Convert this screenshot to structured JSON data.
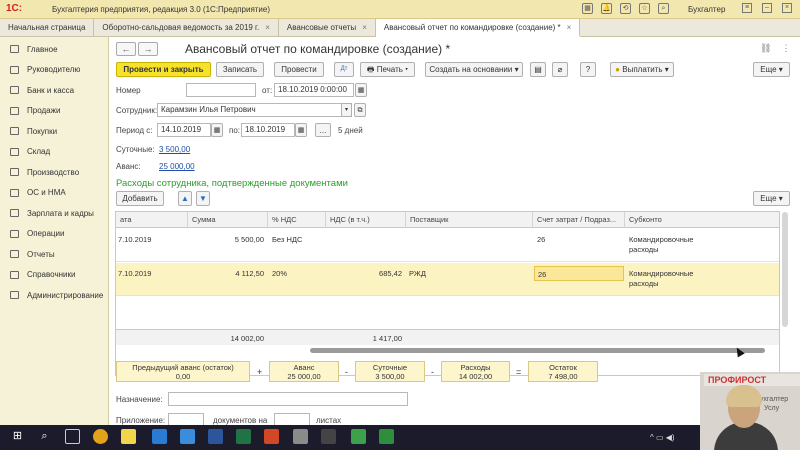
{
  "app": {
    "logo": "1С:",
    "title": "Бухгалтерия предприятия, редакция 3.0  (1С:Предприятие)",
    "user": "Бухгалтер"
  },
  "tabs": [
    {
      "label": "Начальная страница"
    },
    {
      "label": "Оборотно-сальдовая ведомость за 2019 г."
    },
    {
      "label": "Авансовые отчеты"
    },
    {
      "label": "Авансовый отчет по командировке (создание) *"
    }
  ],
  "sidebar": {
    "items": [
      {
        "label": "Главное",
        "icon": "menu-icon"
      },
      {
        "label": "Руководителю",
        "icon": "chart-icon"
      },
      {
        "label": "Банк и касса",
        "icon": "bank-icon"
      },
      {
        "label": "Продажи",
        "icon": "cart-icon"
      },
      {
        "label": "Покупки",
        "icon": "basket-icon"
      },
      {
        "label": "Склад",
        "icon": "warehouse-icon"
      },
      {
        "label": "Производство",
        "icon": "factory-icon"
      },
      {
        "label": "ОС и НМА",
        "icon": "assets-icon"
      },
      {
        "label": "Зарплата и кадры",
        "icon": "people-icon"
      },
      {
        "label": "Операции",
        "icon": "operations-icon"
      },
      {
        "label": "Отчеты",
        "icon": "reports-icon"
      },
      {
        "label": "Справочники",
        "icon": "catalog-icon"
      },
      {
        "label": "Администрирование",
        "icon": "admin-icon"
      }
    ]
  },
  "doc": {
    "title": "Авансовый отчет по командировке (создание) *",
    "toolbar": {
      "post_close": "Провести и закрыть",
      "save": "Записать",
      "post": "Провести",
      "print": "Печать",
      "create_based": "Создать на основании",
      "pay": "Выплатить",
      "more": "Еще",
      "help": "?"
    },
    "fields": {
      "number_label": "Номер",
      "number_value": "",
      "date_from_label": "от:",
      "date_value": "18.10.2019  0:00:00",
      "employee_label": "Сотрудник:",
      "employee_value": "Карамзин Илья Петрович",
      "period_from_label": "Период с:",
      "period_from_value": "14.10.2019",
      "period_to_label": "по:",
      "period_to_value": "18.10.2019",
      "period_days": "5 дней",
      "per_diem_label": "Суточные:",
      "per_diem_value": "3 500,00",
      "advance_label": "Аванс:",
      "advance_value": "25 000,00"
    },
    "section_title": "Расходы сотрудника, подтвержденные документами",
    "add_button": "Добавить",
    "more_button": "Еще",
    "table": {
      "columns": [
        "ата",
        "Сумма",
        "% НДС",
        "НДС (в т.ч.)",
        "Поставщик",
        "Счет затрат / Подраз...",
        "Субконто"
      ],
      "rows": [
        {
          "date": "7.10.2019",
          "sum": "5 500,00",
          "vat_rate": "Без НДС",
          "vat": "",
          "supplier": "",
          "account": "26",
          "subconto_1": "Командировочные",
          "subconto_2": "расходы"
        },
        {
          "date": "7.10.2019",
          "sum": "4 112,50",
          "vat_rate": "20%",
          "vat": "685,42",
          "supplier": "РЖД",
          "account": "26",
          "subconto_1": "Командировочные",
          "subconto_2": "расходы"
        }
      ],
      "footer": {
        "sum": "14 002,00",
        "vat": "1 417,00"
      }
    },
    "summary": [
      {
        "label": "Предыдущий аванс (остаток)",
        "value": "0,00"
      },
      {
        "label": "Аванс",
        "value": "25 000,00"
      },
      {
        "label": "Суточные",
        "value": "3 500,00"
      },
      {
        "label": "Расходы",
        "value": "14 002,00"
      },
      {
        "label": "Остаток",
        "value": "7 498,00"
      }
    ],
    "operators": [
      "+",
      "-",
      "-",
      "="
    ],
    "purpose_label": "Назначение:",
    "purpose_value": "",
    "attachment_label": "Приложение:",
    "attachment_mid": "документов на",
    "attachment_end": "листах"
  },
  "video_overlay": {
    "banner": "ПРОФИРОСТ",
    "text_line1": "бухгалтер",
    "text_line2": "Услу"
  },
  "colors": {
    "accent_yellow": "#f7e22b",
    "titlebar": "#f3e7b0",
    "sidebar": "#f6f2d8",
    "link_blue": "#1f4fa8",
    "section_green": "#2aa02a",
    "row_highlight": "#fcf3c2",
    "taskbar": "#1b1b2b"
  }
}
